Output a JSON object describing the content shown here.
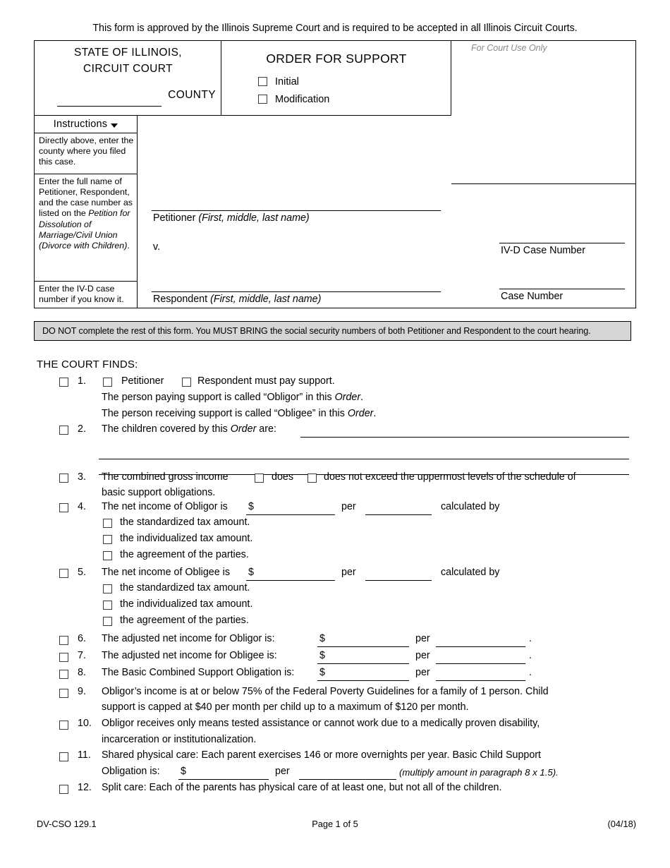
{
  "approval_note": "This form is approved by the Illinois Supreme Court and is required to be accepted in all Illinois Circuit Courts.",
  "header": {
    "state_line1": "STATE OF ILLINOIS,",
    "state_line2": "CIRCUIT COURT",
    "county_label": "COUNTY",
    "form_title": "ORDER FOR SUPPORT",
    "options": [
      {
        "label": "Initial",
        "checked": false
      },
      {
        "label": "Modification",
        "checked": false
      }
    ],
    "court_use_label": "For Court Use Only"
  },
  "instructions": {
    "heading": "Instructions",
    "caret_icon": "chevron-down-icon",
    "blocks": [
      {
        "text": "Directly above, enter the county where you filed this case."
      },
      {
        "prefix": "Enter the full name of Petitioner, Respondent, and the case number as listed on the ",
        "italic": "Petition for Dissolution of Marriage/Civil Union (Divorce with Children)",
        "suffix": "."
      },
      {
        "text": "Enter the IV-D case number if you know it."
      }
    ]
  },
  "parties": {
    "petitioner_label": "Petitioner",
    "petitioner_hint": "(First, middle, last name)",
    "versus": "v.",
    "respondent_label": "Respondent",
    "respondent_hint": "(First, middle, last name)"
  },
  "case_numbers": {
    "ivd_label": "IV-D Case Number",
    "ivd_value": "",
    "case_label": "Case Number",
    "case_value": ""
  },
  "banner": {
    "text": "DO NOT complete the rest of this form. You MUST BRING the social security numbers of both Petitioner and Respondent to the court hearing.",
    "bg_color": "#d6d6d6"
  },
  "findings": {
    "heading": "THE COURT FINDS:",
    "items": [
      {
        "number": "1.",
        "checked": false,
        "sub_checkbox_a": {
          "label": "Petitioner",
          "checked": false
        },
        "sub_checkbox_b": {
          "label": "Respondent must pay support.",
          "checked": false
        },
        "note1": "The person paying support is called “Obligor” in this ",
        "note1_italic": "Order",
        "note1_end": ".",
        "note2": "The person receiving support is called “Obligee” in this ",
        "note2_italic": "Order",
        "note2_end": "."
      },
      {
        "number": "2.",
        "checked": false,
        "text_a": "The children covered by this ",
        "text_italic": "Order",
        "text_b": " are:",
        "blank_lines": 3
      },
      {
        "number": "3.",
        "checked": false,
        "text_a": "The combined gross income",
        "opt_does": {
          "label": "does",
          "checked": false
        },
        "opt_does_not": {
          "label": "does not exceed the uppermost levels of the schedule of",
          "checked": false
        },
        "text_line2": "basic support obligations."
      },
      {
        "number": "4.",
        "checked": false,
        "text": "The net income of Obligor is",
        "currency": "$",
        "amount_value": "",
        "per_label": "per",
        "period_value": "",
        "tail": "calculated by",
        "sub_items": [
          {
            "label": "the standardized tax amount.",
            "checked": false
          },
          {
            "label": "the individualized tax amount.",
            "checked": false
          },
          {
            "label": "the agreement of the parties.",
            "checked": false
          }
        ]
      },
      {
        "number": "5.",
        "checked": false,
        "text": "The net income of Obligee is",
        "currency": "$",
        "amount_value": "",
        "per_label": "per",
        "period_value": "",
        "tail": "calculated by",
        "sub_items": [
          {
            "label": "the standardized tax amount.",
            "checked": false
          },
          {
            "label": "the individualized tax amount.",
            "checked": false
          },
          {
            "label": "the agreement of the parties.",
            "checked": false
          }
        ]
      },
      {
        "number": "6.",
        "checked": false,
        "text": "The adjusted net income for Obligor is:",
        "currency": "$",
        "amount_value": "",
        "per_label": "per",
        "period_value": "",
        "tail": "."
      },
      {
        "number": "7.",
        "checked": false,
        "text": "The adjusted net income for Obligee is:",
        "currency": "$",
        "amount_value": "",
        "per_label": "per",
        "period_value": "",
        "tail": "."
      },
      {
        "number": "8.",
        "checked": false,
        "text": "The Basic Combined Support Obligation is:",
        "currency": "$",
        "amount_value": "",
        "per_label": "per",
        "period_value": "",
        "tail": "."
      },
      {
        "number": "9.",
        "checked": false,
        "line1": "Obligor’s income is at or below 75% of the Federal Poverty Guidelines for a family of 1 person. Child",
        "line2": "support is capped at $40 per month per child up to a maximum of $120 per month."
      },
      {
        "number": "10.",
        "checked": false,
        "line1": "Obligor receives only means tested assistance or cannot work due to a medically proven disability,",
        "line2": "incarceration or institutionalization."
      },
      {
        "number": "11.",
        "checked": false,
        "line1": "Shared physical care: Each parent exercises 146 or more overnights per year.  Basic Child Support",
        "line2_label": "Obligation is:",
        "currency": "$",
        "amount_value": "",
        "per_label": "per",
        "period_value": "",
        "parenthetical": "(multiply amount in paragraph 8 x 1.5)."
      },
      {
        "number": "12.",
        "checked": false,
        "line1": "Split care: Each of the parents has physical care of at least one, but not all of the children."
      }
    ]
  },
  "footer": {
    "form_code": "DV-CSO 129.1",
    "page_label": "Page 1 of 5",
    "revision": "(04/18)"
  }
}
